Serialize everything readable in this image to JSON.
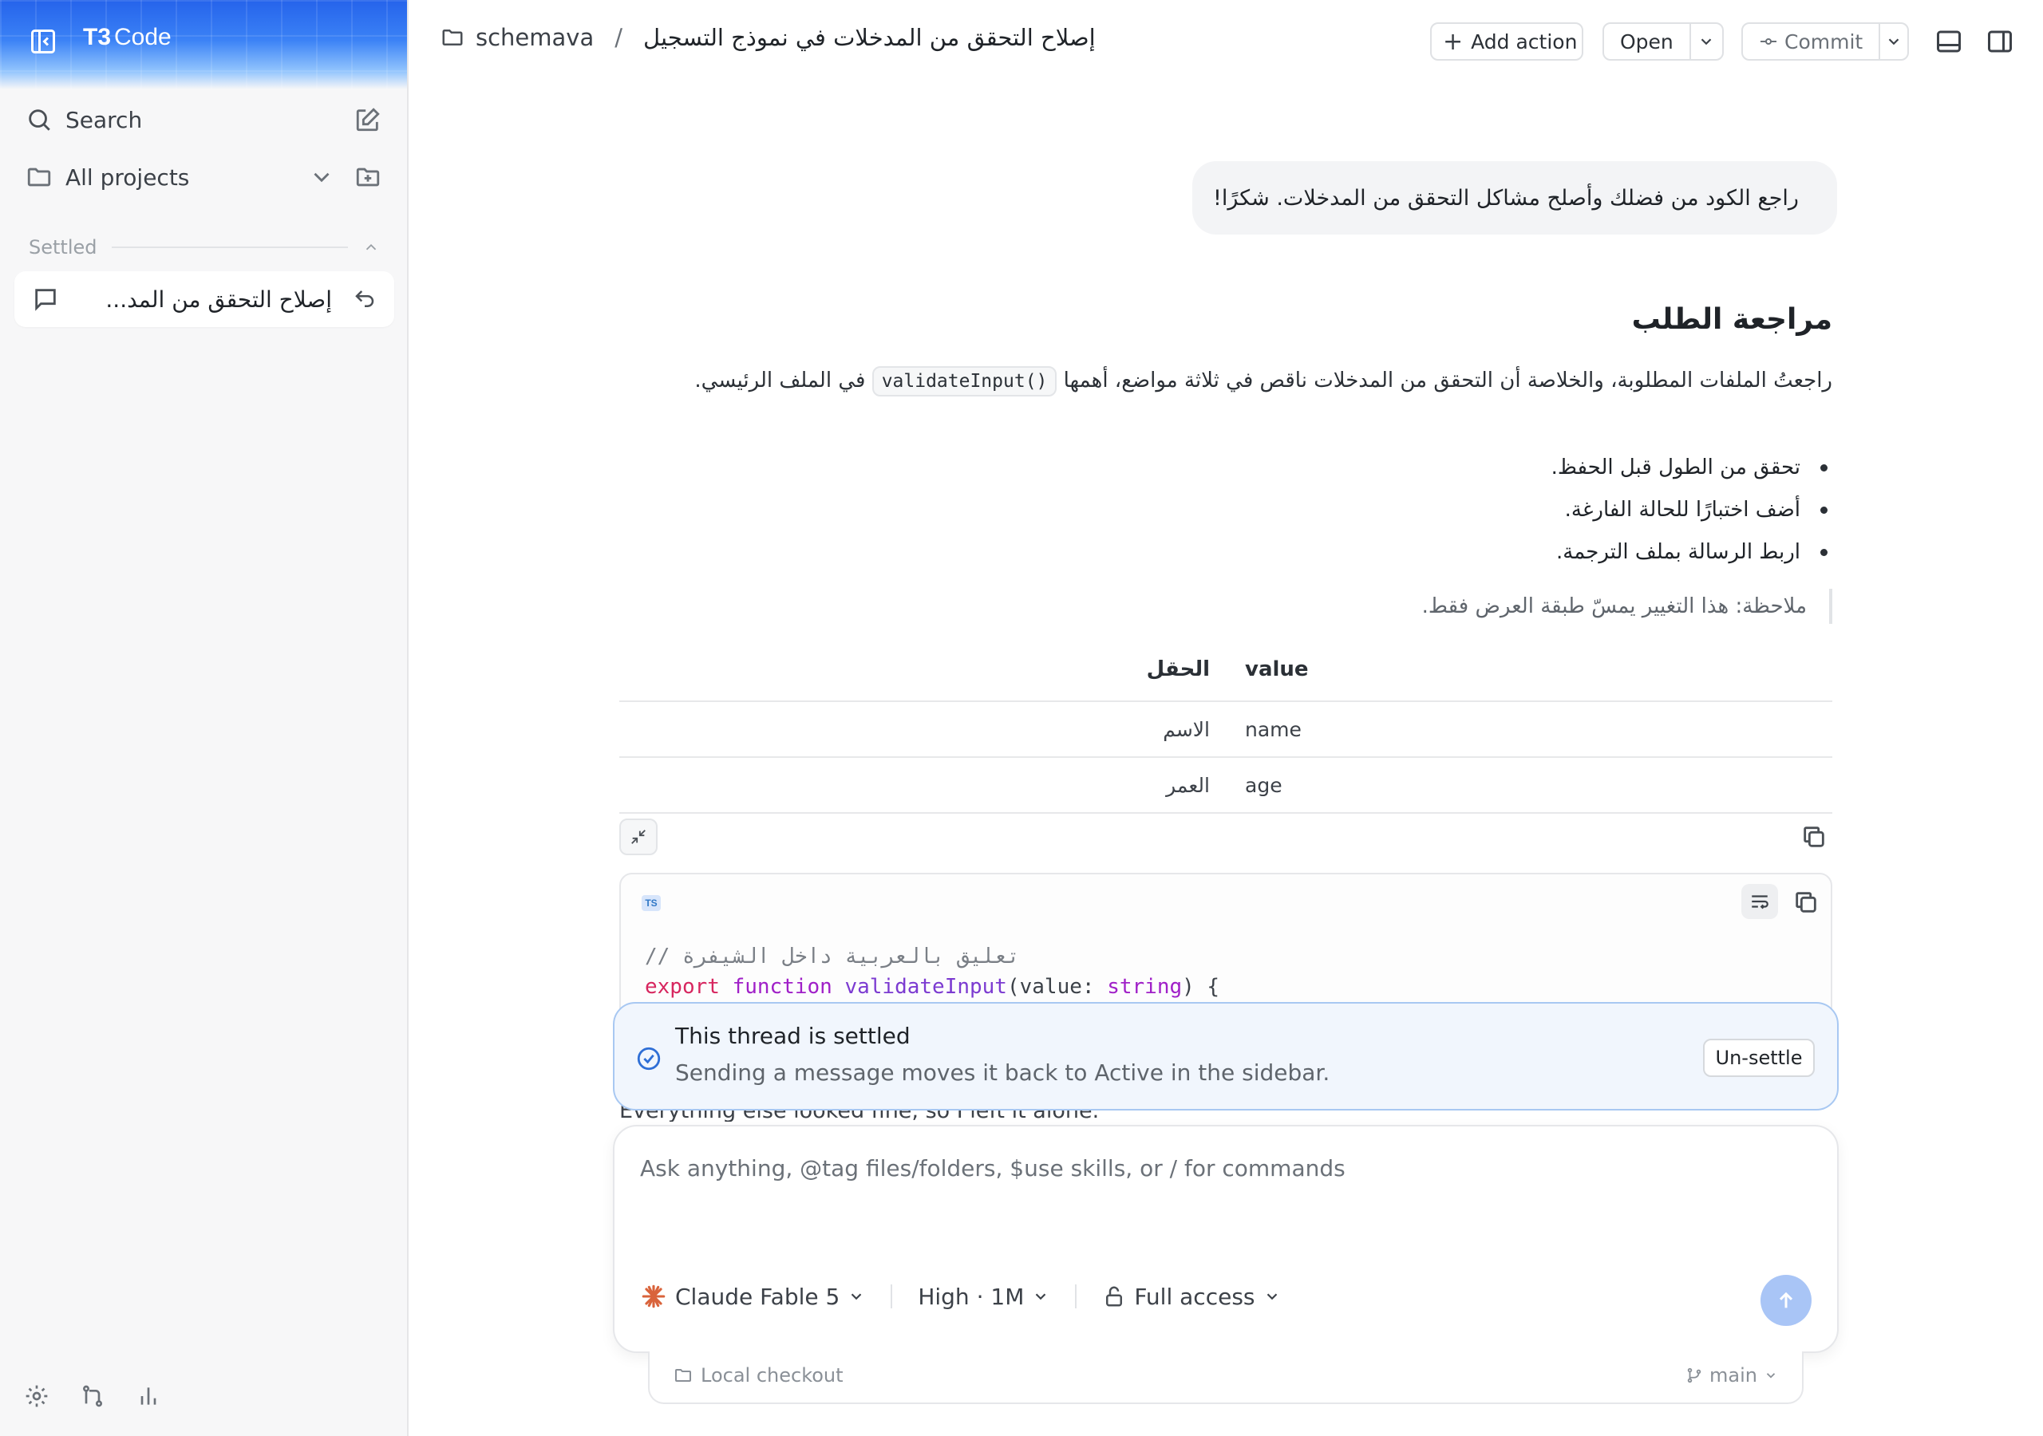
{
  "app": {
    "logo_bold": "T3",
    "logo_text": "Code"
  },
  "sidebar": {
    "search_label": "Search",
    "projects_label": "All projects",
    "section_label": "Settled",
    "threads": [
      {
        "title": "إصلاح التحقق من المد..."
      }
    ]
  },
  "topbar": {
    "project": "schemava",
    "separator": "/",
    "thread_title": "إصلاح التحقق من المدخلات في نموذج التسجيل",
    "add_action_label": "Add action",
    "open_label": "Open",
    "commit_label": "Commit"
  },
  "chat": {
    "user_message": "راجع الكود من فضلك وأصلح مشاكل التحقق من المدخلات. شكرًا!",
    "reply": {
      "heading": "مراجعة الطلب",
      "para_before": "راجعتُ الملفات المطلوبة، والخلاصة أن التحقق من المدخلات ناقص في ثلاثة مواضع، أهمها",
      "inline_code": "validateInput()",
      "para_after": "في الملف الرئيسي.",
      "bullets": [
        "تحقق من الطول قبل الحفظ.",
        "أضف اختبارًا للحالة الفارغة.",
        "اربط الرسالة بملف الترجمة."
      ],
      "note": "ملاحظة: هذا التغيير يمسّ طبقة العرض فقط.",
      "table": {
        "headers": [
          "value",
          "الحقل"
        ],
        "rows": [
          [
            "name",
            "الاسم"
          ],
          [
            "age",
            "العمر"
          ]
        ]
      },
      "code": {
        "lang": "TS",
        "comment": "// تعليق بالعربية داخل الشيفرة",
        "line2": {
          "kw1": "export",
          "kw2": "function",
          "fn": "validateInput",
          "p1": "(value: ",
          "ty": "string",
          "p2": ") {"
        }
      },
      "after_text": "Everything else looked fine, so I left it alone."
    }
  },
  "settled_banner": {
    "title": "This thread is settled",
    "subtitle": "Sending a message moves it back to Active in the sidebar.",
    "button": "Un-settle"
  },
  "composer": {
    "placeholder": "Ask anything, @tag files/folders, $use skills, or / for commands",
    "model": "Claude Fable 5",
    "effort": "High · 1M",
    "access": "Full access",
    "accent": "#a9c5f6"
  },
  "footer": {
    "checkout": "Local checkout",
    "branch": "main"
  }
}
